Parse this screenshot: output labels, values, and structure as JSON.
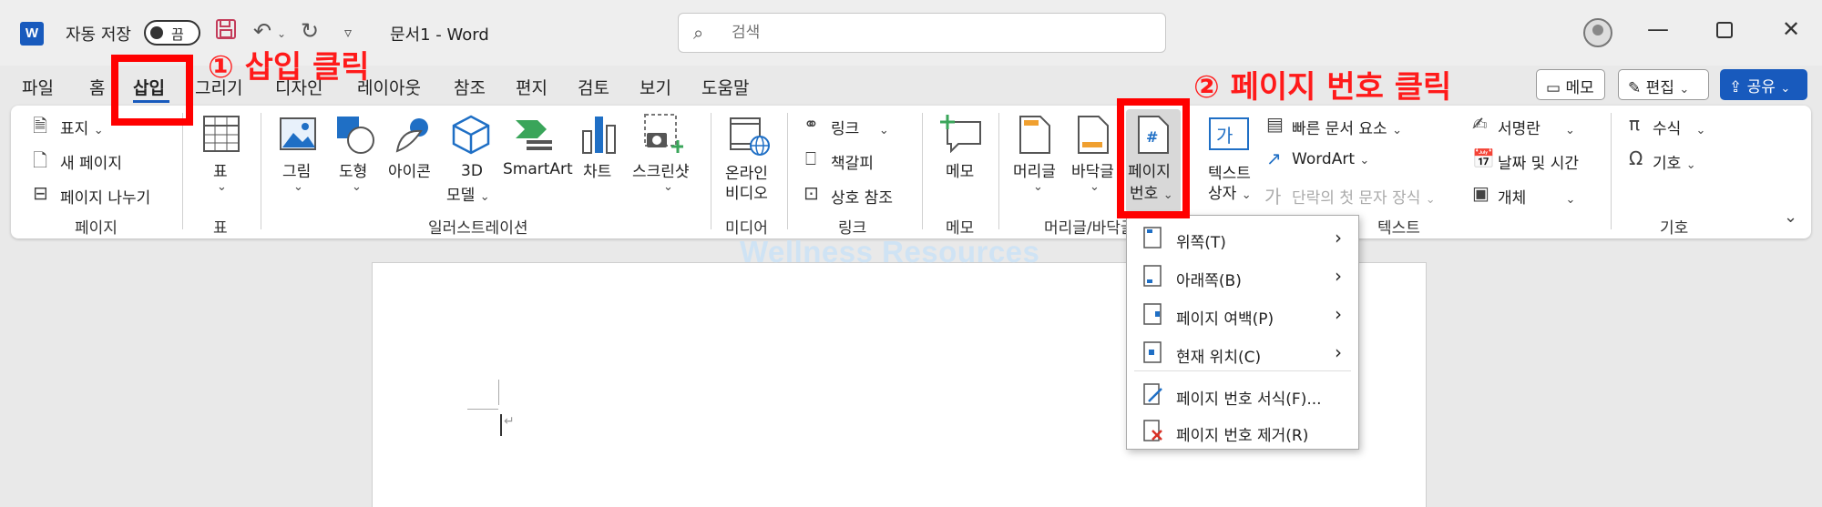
{
  "titlebar": {
    "app_logo": "W",
    "autosave_label": "자동 저장",
    "autosave_state": "끔",
    "doc_title": "문서1  -  Word",
    "search_placeholder": "검색",
    "icons": [
      "save-icon",
      "undo-icon",
      "redo-icon",
      "customize-icon",
      "search-icon",
      "minimize-icon",
      "maximize-icon",
      "close-icon"
    ]
  },
  "tabs": {
    "items": [
      "파일",
      "홈",
      "삽입",
      "그리기",
      "디자인",
      "레이아웃",
      "참조",
      "편지",
      "검토",
      "보기",
      "도움말"
    ],
    "active": "삽입"
  },
  "right_buttons": {
    "memo": "메모",
    "edit": "편집",
    "share": "공유"
  },
  "ribbon": {
    "page_group": {
      "label": "페이지",
      "cover": "표지",
      "new_page": "새 페이지",
      "page_break": "페이지 나누기"
    },
    "table_group": {
      "label": "표",
      "table": "표"
    },
    "illust_group": {
      "label": "일러스트레이션",
      "picture": "그림",
      "shapes": "도형",
      "icons": "아이콘",
      "model3d_1": "3D",
      "model3d_2": "모델",
      "smartart": "SmartArt",
      "chart": "차트",
      "screenshot": "스크린샷"
    },
    "media_group": {
      "label": "미디어",
      "online1": "온라인",
      "online2": "비디오"
    },
    "link_group": {
      "label": "링크",
      "link": "링크",
      "bookmark": "책갈피",
      "crossref": "상호 참조"
    },
    "comment_group": {
      "label": "메모",
      "comment": "메모"
    },
    "hf_group": {
      "label": "머리글/바닥글",
      "header": "머리글",
      "footer": "바닥글",
      "pagenum1": "페이지",
      "pagenum2": "번호"
    },
    "text_group": {
      "label": "텍스트",
      "textbox1": "텍스트",
      "textbox2": "상자",
      "quickparts": "빠른 문서 요소",
      "wordart": "WordArt",
      "dropcap": "단락의 첫 문자 장식",
      "signature": "서명란",
      "datetime": "날짜 및 시간",
      "object": "개체"
    },
    "symbol_group": {
      "label": "기호",
      "equation": "수식",
      "symbol": "기호"
    }
  },
  "dropdown": {
    "items": [
      "위쪽(T)",
      "아래쪽(B)",
      "페이지 여백(P)",
      "현재 위치(C)",
      "페이지 번호 서식(F)...",
      "페이지 번호 제거(R)"
    ]
  },
  "watermark": "Wellness Resources",
  "annotations": {
    "step1": "① 삽입 클릭",
    "step2": "② 페이지 번호 클릭"
  },
  "colors": {
    "accent": "#185abd",
    "highlight": "#ff0000",
    "annotation": "#ff1a1a"
  }
}
